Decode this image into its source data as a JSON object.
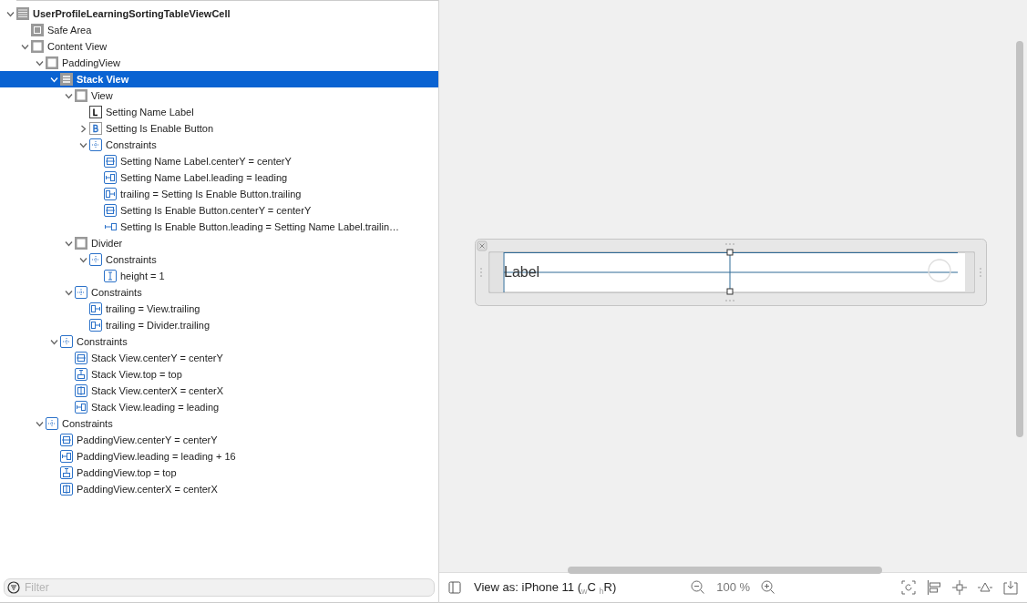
{
  "outline": {
    "items": [
      {
        "label": "UserProfileLearningSortingTableViewCell",
        "kind": "cell",
        "expanded": true,
        "selected": false,
        "children": [
          {
            "label": "Safe Area",
            "kind": "safe",
            "selected": false
          },
          {
            "label": "Content View",
            "kind": "view",
            "expanded": true,
            "selected": false,
            "children": [
              {
                "label": "PaddingView",
                "kind": "view",
                "expanded": true,
                "selected": false,
                "children": [
                  {
                    "label": "Stack View",
                    "kind": "stack",
                    "expanded": true,
                    "selected": true,
                    "children": [
                      {
                        "label": "View",
                        "kind": "view",
                        "expanded": true,
                        "selected": false,
                        "children": [
                          {
                            "label": "Setting Name Label",
                            "kind": "label",
                            "selected": false
                          },
                          {
                            "label": "Setting Is Enable Button",
                            "kind": "button",
                            "expanded": false,
                            "selected": false
                          },
                          {
                            "label": "Constraints",
                            "kind": "constraints",
                            "expanded": true,
                            "selected": false,
                            "children": [
                              {
                                "label": "Setting Name Label.centerY = centerY",
                                "kind": "centery",
                                "selected": false
                              },
                              {
                                "label": "Setting Name Label.leading = leading",
                                "kind": "leading",
                                "selected": false
                              },
                              {
                                "label": "trailing = Setting Is Enable Button.trailing",
                                "kind": "trailing",
                                "selected": false
                              },
                              {
                                "label": "Setting Is Enable Button.centerY = centerY",
                                "kind": "centery",
                                "selected": false
                              },
                              {
                                "label": "Setting Is Enable Button.leading = Setting Name Label.trailin…",
                                "kind": "spacing",
                                "selected": false
                              }
                            ]
                          }
                        ]
                      },
                      {
                        "label": "Divider",
                        "kind": "view",
                        "expanded": true,
                        "selected": false,
                        "children": [
                          {
                            "label": "Constraints",
                            "kind": "constraints",
                            "expanded": true,
                            "selected": false,
                            "children": [
                              {
                                "label": "height = 1",
                                "kind": "height",
                                "selected": false
                              }
                            ]
                          }
                        ]
                      },
                      {
                        "label": "Constraints",
                        "kind": "constraints",
                        "expanded": true,
                        "selected": false,
                        "children": [
                          {
                            "label": "trailing = View.trailing",
                            "kind": "trailing",
                            "selected": false
                          },
                          {
                            "label": "trailing = Divider.trailing",
                            "kind": "trailing",
                            "selected": false
                          }
                        ]
                      }
                    ]
                  },
                  {
                    "label": "Constraints",
                    "kind": "constraints",
                    "expanded": true,
                    "selected": false,
                    "children": [
                      {
                        "label": "Stack View.centerY = centerY",
                        "kind": "centery",
                        "selected": false
                      },
                      {
                        "label": "Stack View.top = top",
                        "kind": "top",
                        "selected": false
                      },
                      {
                        "label": "Stack View.centerX = centerX",
                        "kind": "centerx",
                        "selected": false
                      },
                      {
                        "label": "Stack View.leading = leading",
                        "kind": "leading",
                        "selected": false
                      }
                    ]
                  }
                ]
              },
              {
                "label": "Constraints",
                "kind": "constraints",
                "expanded": true,
                "selected": false,
                "children": [
                  {
                    "label": "PaddingView.centerY = centerY",
                    "kind": "centery",
                    "selected": false
                  },
                  {
                    "label": "PaddingView.leading = leading + 16",
                    "kind": "leading",
                    "selected": false
                  },
                  {
                    "label": "PaddingView.top = top",
                    "kind": "top",
                    "selected": false
                  },
                  {
                    "label": "PaddingView.centerX = centerX",
                    "kind": "centerx",
                    "selected": false
                  }
                ]
              }
            ]
          }
        ]
      }
    ]
  },
  "filter": {
    "placeholder": "Filter"
  },
  "canvas": {
    "cell_label": "Label"
  },
  "status_bar": {
    "view_as": "View as: iPhone 11 ($_{w}$C $_{h}$R)",
    "zoom": "100 %"
  }
}
